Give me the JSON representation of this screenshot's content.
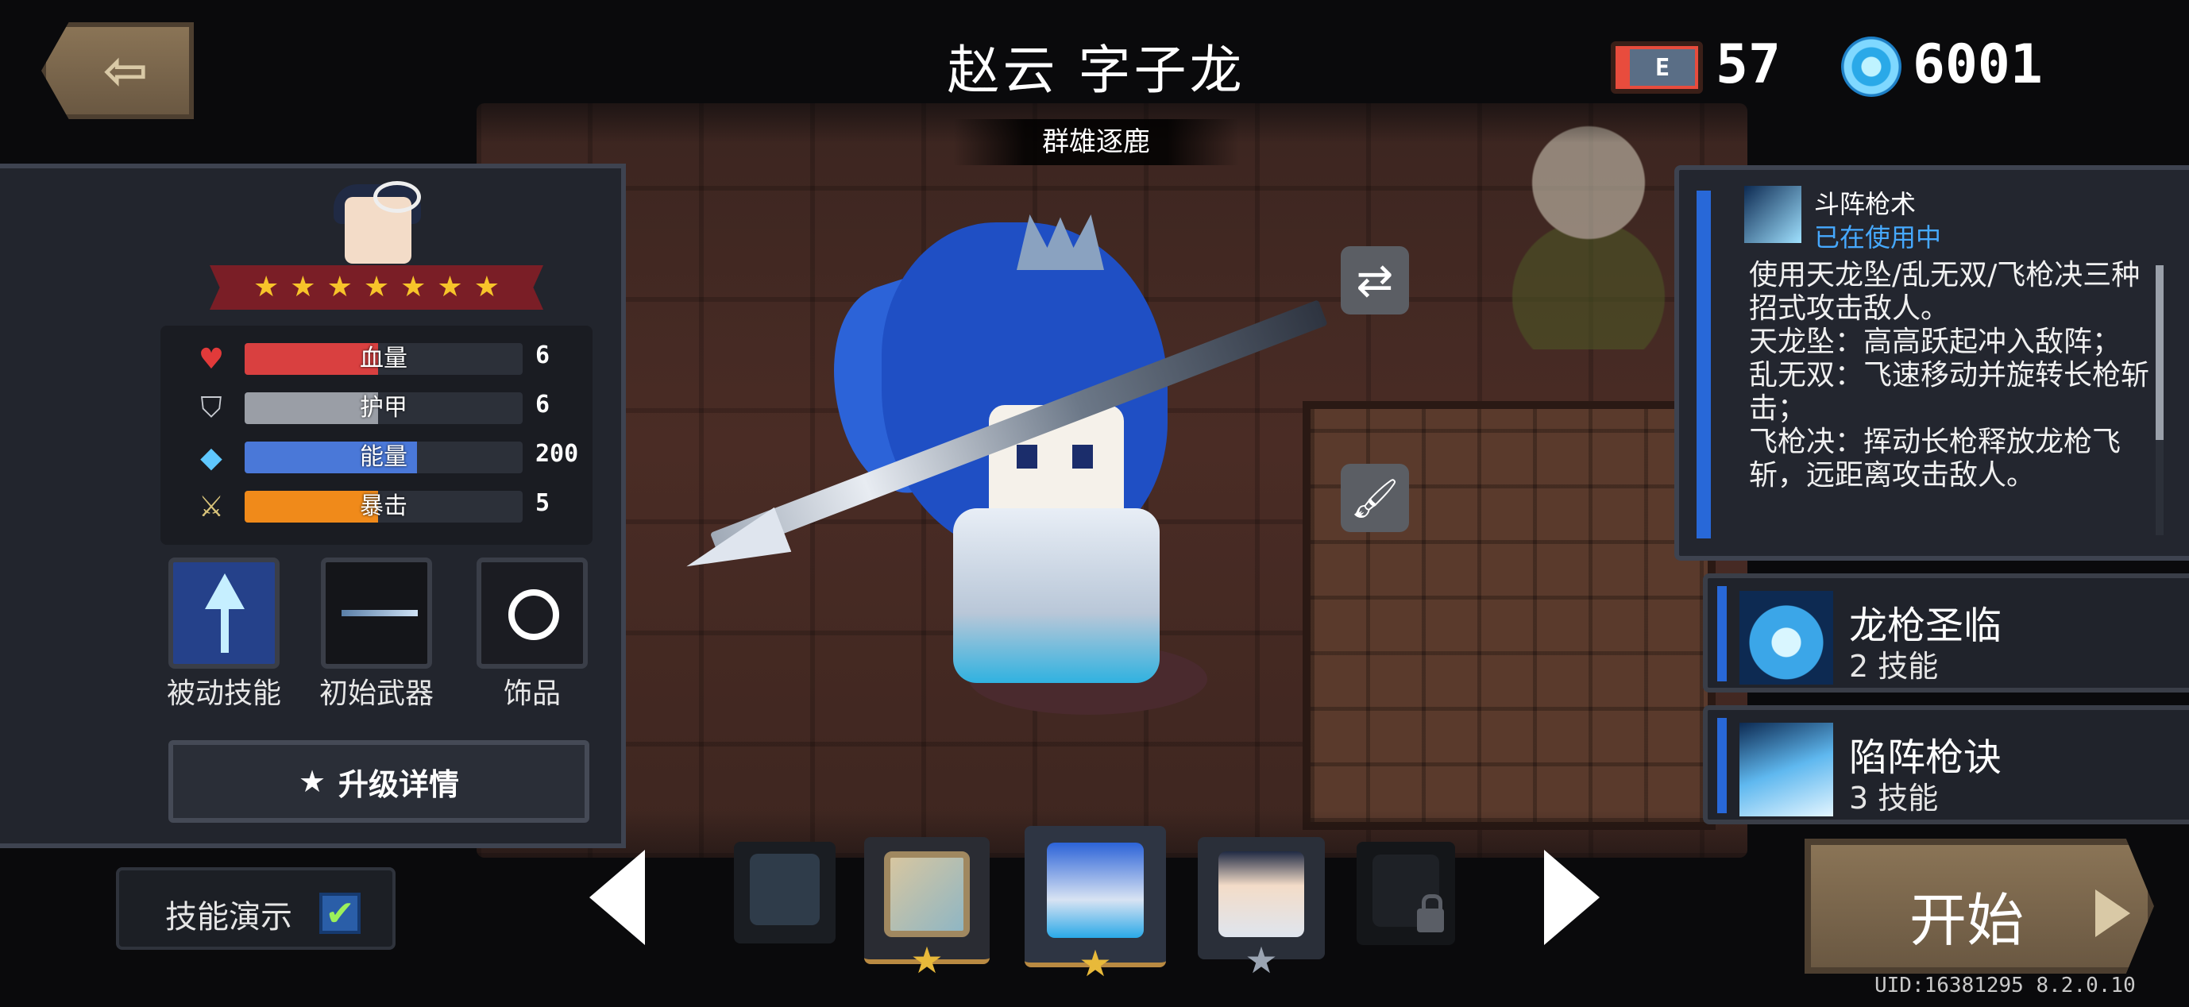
{
  "header": {
    "hero_name": "赵云  字子龙",
    "hero_subtitle": "群雄逐鹿",
    "ticket_label": "E",
    "ticket_count": "57",
    "gem_count": "6001"
  },
  "left_panel": {
    "stars": 7,
    "stats": [
      {
        "label": "血量",
        "value": "6",
        "icon": "heart-icon",
        "fill": 0.48,
        "color": "#d94040"
      },
      {
        "label": "护甲",
        "value": "6",
        "icon": "shield-icon",
        "fill": 0.48,
        "color": "#9a9ea6"
      },
      {
        "label": "能量",
        "value": "200",
        "icon": "diamond-icon",
        "fill": 0.62,
        "color": "#4a78d8"
      },
      {
        "label": "暴击",
        "value": "5",
        "icon": "sword-icon",
        "fill": 0.48,
        "color": "#f08a1a"
      }
    ],
    "equip": {
      "passive_label": "被动技能",
      "weapon_label": "初始武器",
      "accessory_label": "饰品"
    },
    "upgrade_label": "升级详情",
    "upgrade_star": "★"
  },
  "skill_demo": {
    "label": "技能演示",
    "checked": true,
    "check_glyph": "✔"
  },
  "skill_panel": {
    "title": "斗阵枪术",
    "status": "已在使用中",
    "description": "使用天龙坠/乱无双/飞枪决三种招式攻击敌人。\n天龙坠：高高跃起冲入敌阵；\n乱无双：飞速移动并旋转长枪斩击；\n飞枪决：挥动长枪释放龙枪飞斩，远距离攻击敌人。"
  },
  "skill_cards": [
    {
      "name": "龙枪圣临",
      "number": "2",
      "type": "技能"
    },
    {
      "name": "陷阵枪诀",
      "number": "3",
      "type": "技能"
    }
  ],
  "selector": {
    "slots": [
      {
        "name": "char-slot-1",
        "star": ""
      },
      {
        "name": "char-slot-2",
        "star": "★"
      },
      {
        "name": "char-slot-3",
        "star": "★"
      },
      {
        "name": "char-slot-4",
        "star": "★"
      },
      {
        "name": "char-slot-5-locked",
        "star": ""
      }
    ],
    "star_colors": [
      "#e8b93a",
      "#e8b93a",
      "#9aa4b2"
    ]
  },
  "start_button": {
    "label": "开始"
  },
  "footer": {
    "uid": "UID:16381295  8.2.0.10"
  },
  "colors": {
    "accent_blue": "#2868d8",
    "status_blue": "#46a9ff",
    "gold": "#f7c42a"
  }
}
